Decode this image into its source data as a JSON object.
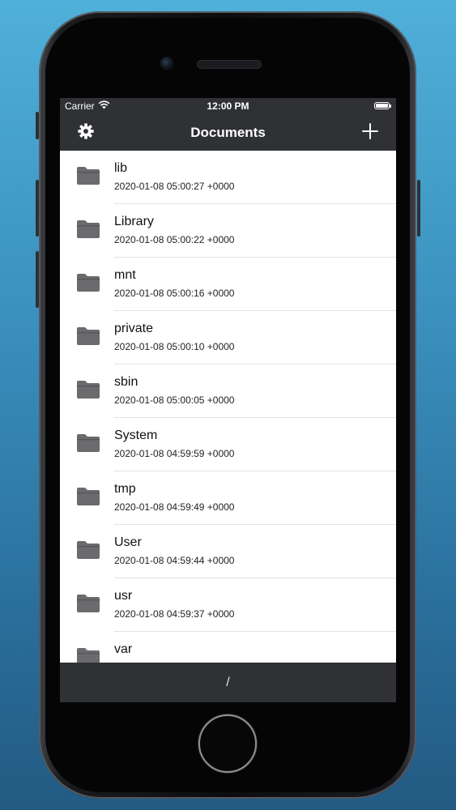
{
  "status_bar": {
    "carrier": "Carrier",
    "time": "12:00 PM"
  },
  "nav": {
    "title": "Documents",
    "left_icon": "gear-icon",
    "right_icon": "plus-icon"
  },
  "files": [
    {
      "name": "lib",
      "date": "2020-01-08 05:00:27 +0000"
    },
    {
      "name": "Library",
      "date": "2020-01-08 05:00:22 +0000"
    },
    {
      "name": "mnt",
      "date": "2020-01-08 05:00:16 +0000"
    },
    {
      "name": "private",
      "date": "2020-01-08 05:00:10 +0000"
    },
    {
      "name": "sbin",
      "date": "2020-01-08 05:00:05 +0000"
    },
    {
      "name": "System",
      "date": "2020-01-08 04:59:59 +0000"
    },
    {
      "name": "tmp",
      "date": "2020-01-08 04:59:49 +0000"
    },
    {
      "name": "User",
      "date": "2020-01-08 04:59:44 +0000"
    },
    {
      "name": "usr",
      "date": "2020-01-08 04:59:37 +0000"
    },
    {
      "name": "var",
      "date": ""
    }
  ],
  "toolbar": {
    "path": "/"
  },
  "colors": {
    "bar_background": "#2f3135",
    "folder_icon": "#6b6b6e",
    "background_top": "#4fb0d9",
    "background_bottom": "#225a82"
  }
}
